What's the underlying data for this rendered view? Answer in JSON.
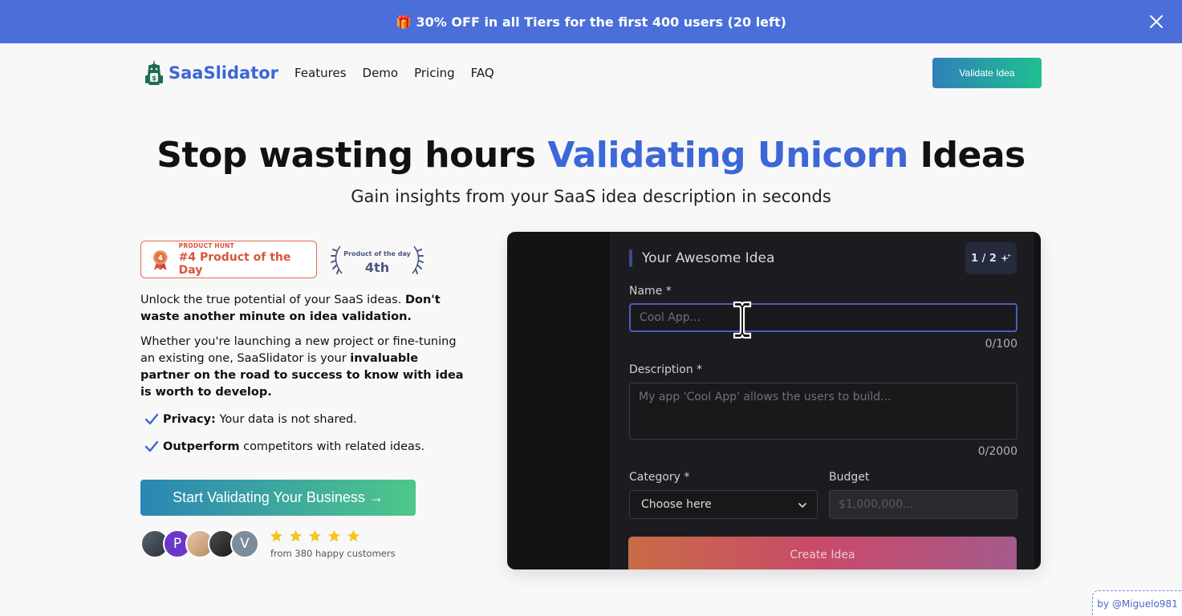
{
  "banner": {
    "text": "🎁 30% OFF in all Tiers for the first 400 users (20 left)"
  },
  "nav": {
    "brand": "SaaSlidator",
    "links": [
      "Features",
      "Demo",
      "Pricing",
      "FAQ"
    ],
    "cta": "Validate Idea"
  },
  "hero": {
    "headline_start": "Stop wasting hours",
    "headline_accent": "Validating Unicorn",
    "headline_end": "Ideas",
    "subheadline": "Gain insights from your SaaS idea description in seconds"
  },
  "badges": {
    "product_hunt_label": "PRODUCT HUNT",
    "product_hunt_rank": "#4 Product of the Day",
    "medal_number": "4",
    "potd_label": "Product of the day",
    "potd_rank": "4th"
  },
  "body": {
    "p1_text": "Unlock the true potential of your SaaS ideas. ",
    "p1_bold": "Don't waste another minute on idea validation.",
    "p2_text": "Whether you're launching a new project or fine-tuning an existing one, SaaSlidator is your ",
    "p2_bold": "invaluable partner on the road to success to know with idea is worth to develop.",
    "check1_bold": "Privacy:",
    "check1_text": " Your data is not shared.",
    "check2_bold": "Outperform",
    "check2_text": " competitors with related ideas.",
    "cta": "Start Validating Your Business →"
  },
  "social": {
    "avatars": [
      "",
      "P",
      "",
      "",
      "V"
    ],
    "rating_stars": 5,
    "customers": "from 380 happy customers"
  },
  "demo": {
    "title": "Your Awesome Idea",
    "step": "1 / 2",
    "name_label": "Name *",
    "name_placeholder": "Cool App...",
    "name_count": "0/100",
    "desc_label": "Description *",
    "desc_placeholder": "My app 'Cool App' allows the users to build...",
    "desc_count": "0/2000",
    "category_label": "Category *",
    "category_value": "Choose here",
    "budget_label": "Budget",
    "budget_placeholder": "$1,000,000...",
    "create_button": "Create Idea"
  },
  "credit": "by @Miguelo981",
  "colors": {
    "banner": "#4a6fd9",
    "brand": "#3d67d6",
    "cta_gradient_start": "#2a86b4",
    "cta_gradient_end": "#4fc78a",
    "star": "#f5c518",
    "check": "#3d67d6"
  }
}
